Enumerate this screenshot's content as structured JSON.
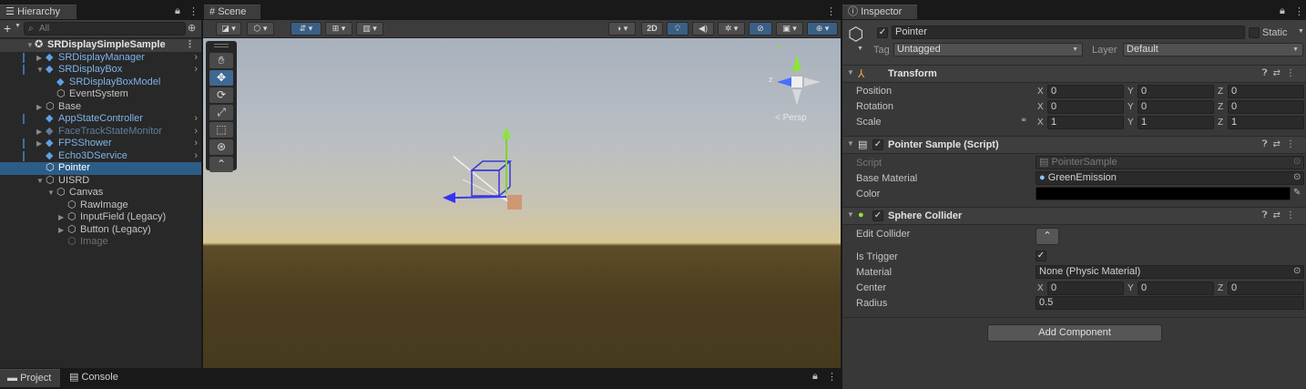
{
  "hierarchy": {
    "tab": "Hierarchy",
    "add": "+",
    "search_placeholder": "All",
    "items": [
      {
        "label": "SRDisplaySimpleSample",
        "kind": "scene",
        "indent": 0
      },
      {
        "label": "SRDisplayManager",
        "kind": "prefab",
        "indent": 1
      },
      {
        "label": "SRDisplayBox",
        "kind": "prefab",
        "indent": 1
      },
      {
        "label": "SRDisplayBoxModel",
        "kind": "prefab-child",
        "indent": 2
      },
      {
        "label": "EventSystem",
        "kind": "object",
        "indent": 2
      },
      {
        "label": "Base",
        "kind": "object",
        "indent": 1
      },
      {
        "label": "AppStateController",
        "kind": "prefab",
        "indent": 1
      },
      {
        "label": "FaceTrackStateMonitor",
        "kind": "prefab-dim",
        "indent": 1
      },
      {
        "label": "FPSShower",
        "kind": "prefab",
        "indent": 1
      },
      {
        "label": "Echo3DService",
        "kind": "prefab",
        "indent": 1
      },
      {
        "label": "Pointer",
        "kind": "selected",
        "indent": 1
      },
      {
        "label": "UISRD",
        "kind": "object",
        "indent": 1
      },
      {
        "label": "Canvas",
        "kind": "object",
        "indent": 2
      },
      {
        "label": "RawImage",
        "kind": "object",
        "indent": 3
      },
      {
        "label": "InputField (Legacy)",
        "kind": "object",
        "indent": 3
      },
      {
        "label": "Button (Legacy)",
        "kind": "object",
        "indent": 3
      },
      {
        "label": "Image",
        "kind": "disabled",
        "indent": 3
      }
    ]
  },
  "scene": {
    "tab": "Scene",
    "toolbar_2d": "2D",
    "persp_label": "< Persp",
    "gizmo_z": "z"
  },
  "inspector": {
    "tab": "Inspector",
    "object_name": "Pointer",
    "static_label": "Static",
    "tag_label": "Tag",
    "tag_value": "Untagged",
    "layer_label": "Layer",
    "layer_value": "Default",
    "transform": {
      "title": "Transform",
      "position_label": "Position",
      "rotation_label": "Rotation",
      "scale_label": "Scale",
      "position": {
        "x": "0",
        "y": "0",
        "z": "0"
      },
      "rotation": {
        "x": "0",
        "y": "0",
        "z": "0"
      },
      "scale": {
        "x": "1",
        "y": "1",
        "z": "1"
      }
    },
    "pointer_sample": {
      "title": "Pointer Sample (Script)",
      "script_label": "Script",
      "script_value": "PointerSample",
      "base_material_label": "Base Material",
      "base_material_value": "GreenEmission",
      "color_label": "Color",
      "color_value": "#000000"
    },
    "sphere_collider": {
      "title": "Sphere Collider",
      "edit_collider_label": "Edit Collider",
      "is_trigger_label": "Is Trigger",
      "material_label": "Material",
      "material_value": "None (Physic Material)",
      "center_label": "Center",
      "center": {
        "x": "0",
        "y": "0",
        "z": "0"
      },
      "radius_label": "Radius",
      "radius_value": "0.5"
    },
    "add_component": "Add Component"
  },
  "axis_labels": {
    "x": "X",
    "y": "Y",
    "z": "Z"
  },
  "bottom": {
    "project_tab": "Project",
    "console_tab": "Console"
  },
  "colors": {
    "selection": "#2c5d87",
    "prefab_text": "#7fb3ea",
    "panel": "#383838"
  }
}
